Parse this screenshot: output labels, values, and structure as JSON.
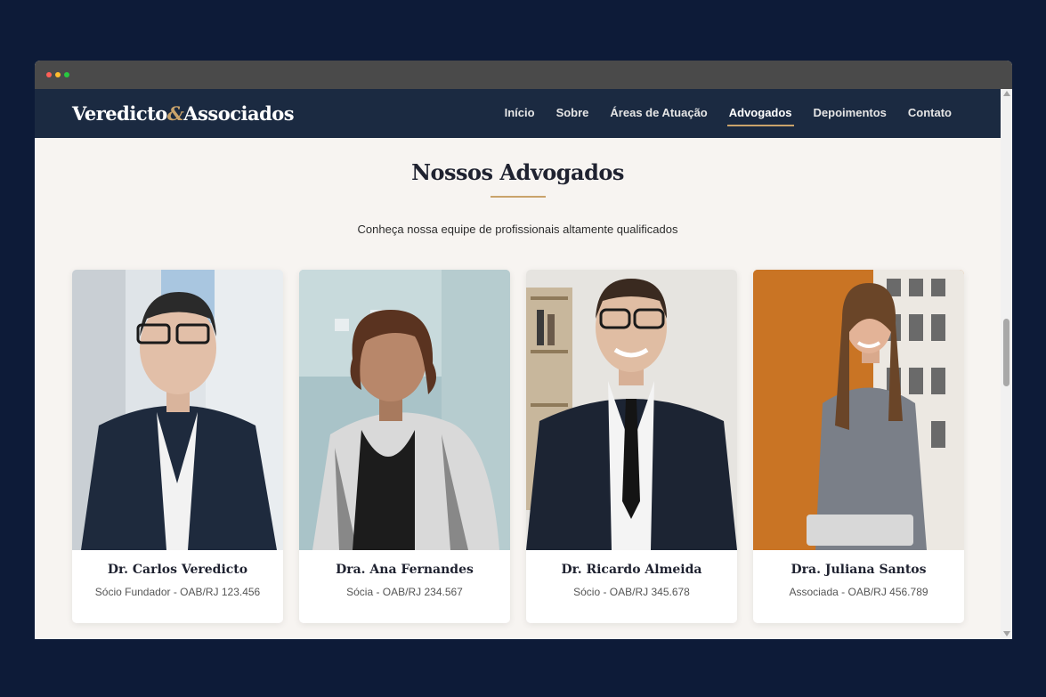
{
  "header": {
    "logo_main": "Veredicto",
    "logo_amp": "&",
    "logo_rest": "Associados"
  },
  "nav": {
    "items": [
      "Início",
      "Sobre",
      "Áreas de Atuação",
      "Advogados",
      "Depoimentos",
      "Contato"
    ],
    "active": "Advogados"
  },
  "section": {
    "title": "Nossos Advogados",
    "subtitle": "Conheça nossa equipe de profissionais altamente qualificados"
  },
  "lawyers": [
    {
      "name": "Dr. Carlos Veredicto",
      "role": "Sócio Fundador - OAB/RJ 123.456"
    },
    {
      "name": "Dra. Ana Fernandes",
      "role": "Sócia - OAB/RJ 234.567"
    },
    {
      "name": "Dr. Ricardo Almeida",
      "role": "Sócio - OAB/RJ 345.678"
    },
    {
      "name": "Dra. Juliana Santos",
      "role": "Associada - OAB/RJ 456.789"
    }
  ],
  "colors": {
    "page_background": "#0d1b38",
    "navbar": "#1b2a41",
    "accent_gold": "#c9a36b",
    "content_background": "#f7f4f1"
  }
}
